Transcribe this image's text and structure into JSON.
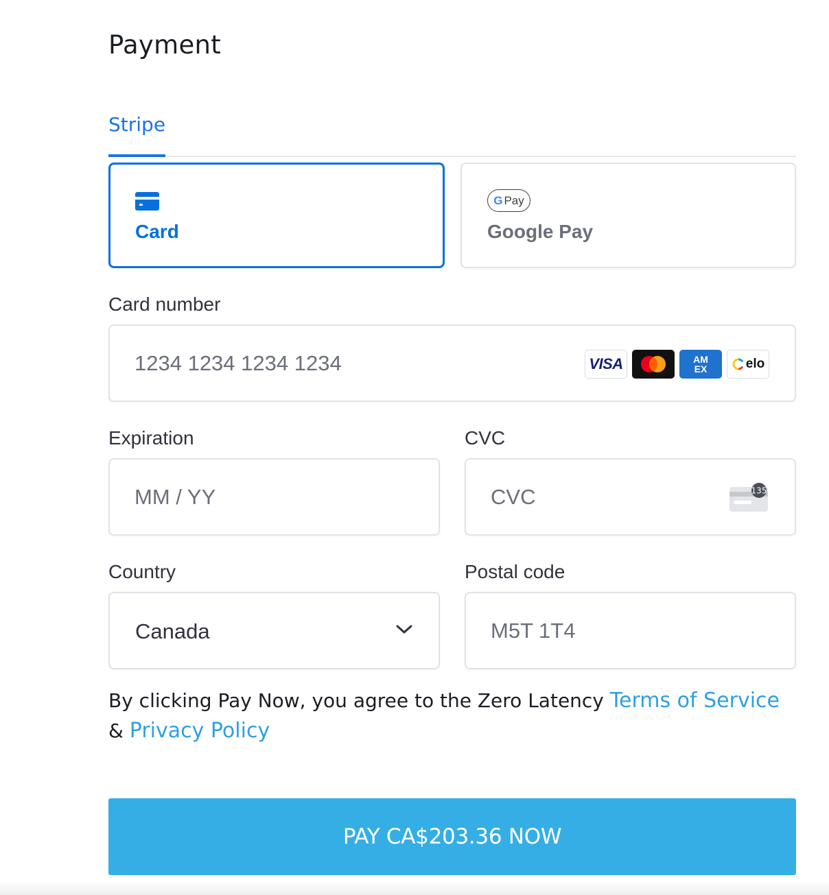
{
  "page": {
    "title": "Payment"
  },
  "tabs": [
    {
      "label": "Stripe",
      "active": true
    }
  ],
  "methods": {
    "card": {
      "label": "Card",
      "selected": true,
      "icon": "credit-card-icon"
    },
    "google_pay": {
      "label": "Google Pay",
      "badge_g": "G",
      "badge_text": "Pay",
      "icon": "google-pay-icon"
    }
  },
  "fields": {
    "card_number": {
      "label": "Card number",
      "placeholder": "1234 1234 1234 1234",
      "value": ""
    },
    "expiration": {
      "label": "Expiration",
      "placeholder": "MM / YY",
      "value": ""
    },
    "cvc": {
      "label": "CVC",
      "placeholder": "CVC",
      "value": "",
      "hint_number": "135"
    },
    "country": {
      "label": "Country",
      "value": "Canada"
    },
    "postal": {
      "label": "Postal code",
      "placeholder": "M5T 1T4",
      "value": ""
    }
  },
  "brands": {
    "visa": "VISA",
    "amex_top": "AM",
    "amex_bottom": "EX",
    "elo": "elo"
  },
  "consent": {
    "text": "By clicking Pay Now, you agree to the Zero Latency",
    "terms_link": "Terms of Service",
    "amp": "&",
    "privacy_link": "Privacy Policy"
  },
  "pay_button": {
    "label": "PAY CA$203.36 NOW"
  },
  "colors": {
    "accent": "#0570de",
    "tab_blue": "#1a73e8",
    "link": "#2f9fe0",
    "pay_button": "#35aee6"
  }
}
